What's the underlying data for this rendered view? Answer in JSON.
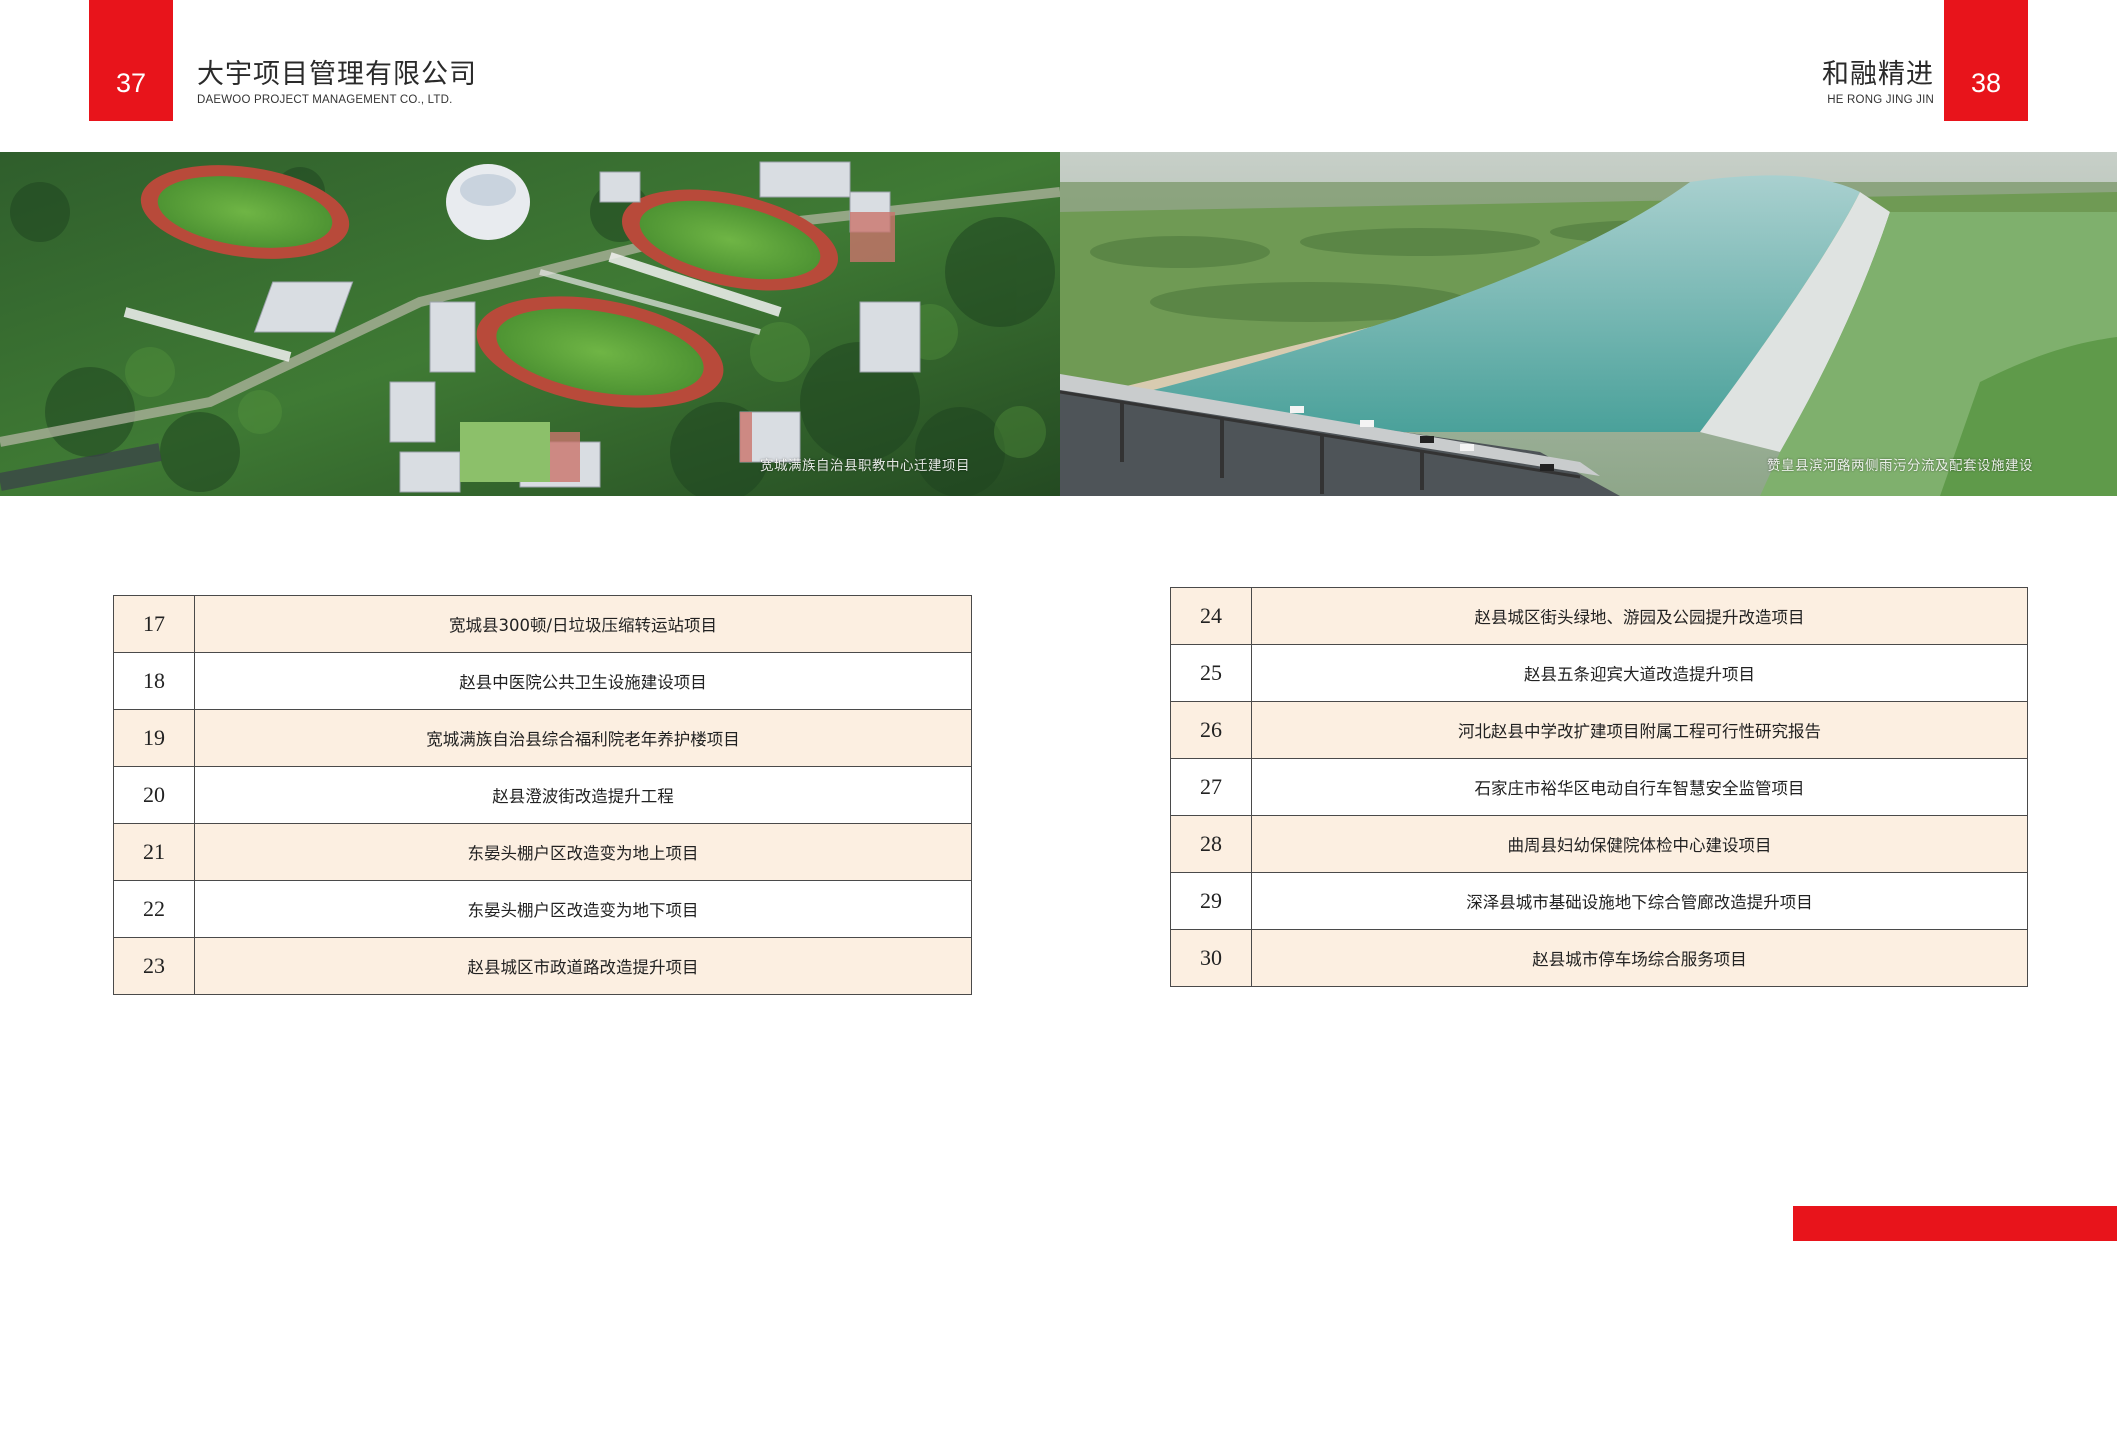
{
  "left_page": {
    "page_number": "37",
    "company_name": "大宇项目管理有限公司",
    "company_name_en": "DAEWOO PROJECT MANAGEMENT CO., LTD.",
    "photo_caption": "宽城满族自治县职教中心迁建项目"
  },
  "right_page": {
    "page_number": "38",
    "slogan": "和融精进",
    "slogan_en": "HE RONG JING JIN",
    "photo_caption": "赞皇县滨河路两侧雨污分流及配套设施建设"
  },
  "projects_left": [
    {
      "no": "17",
      "title": "宽城县300顿/日垃圾压缩转运站项目"
    },
    {
      "no": "18",
      "title": "赵县中医院公共卫生设施建设项目"
    },
    {
      "no": "19",
      "title": "宽城满族自治县综合福利院老年养护楼项目"
    },
    {
      "no": "20",
      "title": "赵县澄波街改造提升工程"
    },
    {
      "no": "21",
      "title": "东晏头棚户区改造变为地上项目"
    },
    {
      "no": "22",
      "title": "东晏头棚户区改造变为地下项目"
    },
    {
      "no": "23",
      "title": "赵县城区市政道路改造提升项目"
    }
  ],
  "projects_right": [
    {
      "no": "24",
      "title": "赵县城区街头绿地、游园及公园提升改造项目"
    },
    {
      "no": "25",
      "title": "赵县五条迎宾大道改造提升项目"
    },
    {
      "no": "26",
      "title": "河北赵县中学改扩建项目附属工程可行性研究报告"
    },
    {
      "no": "27",
      "title": "石家庄市裕华区电动自行车智慧安全监管项目"
    },
    {
      "no": "28",
      "title": "曲周县妇幼保健院体检中心建设项目"
    },
    {
      "no": "29",
      "title": "深泽县城市基础设施地下综合管廊改造提升项目"
    },
    {
      "no": "30",
      "title": "赵县城市停车场综合服务项目"
    }
  ],
  "colors": {
    "accent_red": "#e8141b",
    "row_shade": "#fcefe1",
    "table_border": "#4a4a4a"
  }
}
